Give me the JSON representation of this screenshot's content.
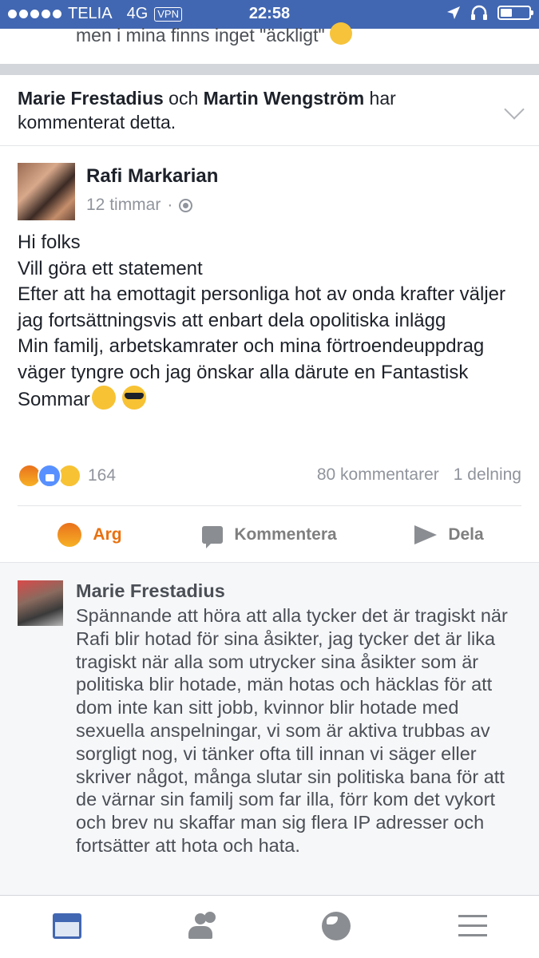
{
  "status_bar": {
    "carrier": "TELIA",
    "network": "4G",
    "vpn": "VPN",
    "time": "22:58"
  },
  "previous_comment": {
    "text": "men i mina finns inget \"äckligt\""
  },
  "notice": {
    "name1": "Marie Frestadius",
    "connector": " och ",
    "name2": "Martin Wengström",
    "suffix": " har kommenterat detta."
  },
  "post": {
    "author": "Rafi Markarian",
    "time": "12 timmar",
    "separator": "·",
    "lines": [
      "Hi folks",
      "Vill göra ett statement",
      "Efter att ha emottagit personliga hot av onda krafter väljer jag fortsättningsvis att enbart dela opolitiska inlägg",
      "Min familj, arbetskamrater och mina förtroendeuppdrag väger tyngre och jag önskar alla därute en Fantastisk Sommar"
    ],
    "emoji_names": [
      "smiling-emoji",
      "sunglasses-emoji"
    ],
    "reaction_count": "164",
    "comments_count": "80 kommentarer",
    "shares_count": "1 delning"
  },
  "actions": {
    "react_label": "Arg",
    "comment_label": "Kommentera",
    "share_label": "Dela"
  },
  "comment": {
    "author": "Marie Frestadius",
    "text": "Spännande att höra att alla tycker det är tragiskt när Rafi blir hotad för sina åsikter, jag tycker det är lika tragiskt när alla som utrycker sina åsikter som är politiska blir hotade, män hotas och häcklas för att dom inte kan sitt jobb, kvinnor blir hotade med sexuella anspelningar, vi som är aktiva trubbas av sorgligt nog, vi tänker ofta till innan vi säger eller skriver något, många slutar sin politiska bana för att de värnar sin familj som far illa, förr kom det vykort och brev nu skaffar man sig flera IP adresser och fortsätter att hota och hata."
  },
  "colors": {
    "brand": "#4267b2",
    "angry": "#e9710f",
    "meta_grey": "#90949c"
  },
  "icons": {
    "tabs": [
      "news-feed-icon",
      "friends-icon",
      "globe-icon",
      "menu-icon"
    ]
  }
}
